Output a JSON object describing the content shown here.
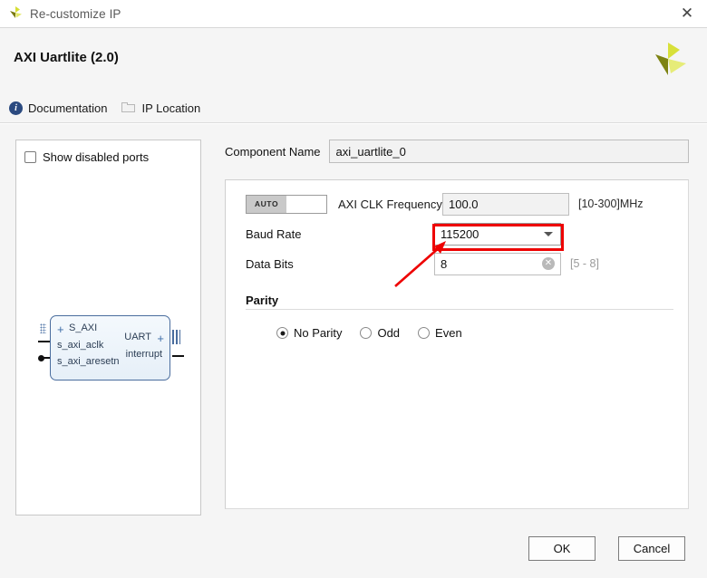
{
  "window": {
    "title": "Re-customize IP",
    "app_icon": "xilinx-logo-icon",
    "close_label": "✕"
  },
  "header": {
    "ip_title": "AXI Uartlite (2.0)",
    "logo": "xilinx-logo"
  },
  "links": [
    {
      "label": "Documentation",
      "icon": "info-icon"
    },
    {
      "label": "IP Location",
      "icon": "folder-icon"
    }
  ],
  "preview": {
    "show_disabled_ports": {
      "label": "Show disabled ports",
      "checked": false
    },
    "diagram": {
      "bus_port": "S_AXI",
      "left_ports": [
        "s_axi_aclk",
        "s_axi_aresetn"
      ],
      "right_bus_port": "UART",
      "right_ports": [
        "interrupt"
      ],
      "plus_glyph": "+"
    }
  },
  "form": {
    "component_name": {
      "label": "Component Name",
      "value": "axi_uartlite_0"
    },
    "clk_freq": {
      "auto_label": "AUTO",
      "label": "AXI CLK Frequency",
      "value": "100.0",
      "hint": "[10-300]MHz"
    },
    "baud_rate": {
      "label": "Baud Rate",
      "value": "115200"
    },
    "data_bits": {
      "label": "Data Bits",
      "value": "8",
      "hint": "[5 - 8]",
      "clear_glyph": "✕"
    },
    "parity": {
      "title": "Parity",
      "options": [
        {
          "label": "No Parity",
          "selected": true
        },
        {
          "label": "Odd",
          "selected": false
        },
        {
          "label": "Even",
          "selected": false
        }
      ]
    }
  },
  "footer": {
    "ok_label": "OK",
    "cancel_label": "Cancel"
  },
  "annotations": {
    "highlight_color": "#ee0000",
    "highlight_target": "baud-rate-combo",
    "arrow_target": "baud-rate-combo"
  }
}
